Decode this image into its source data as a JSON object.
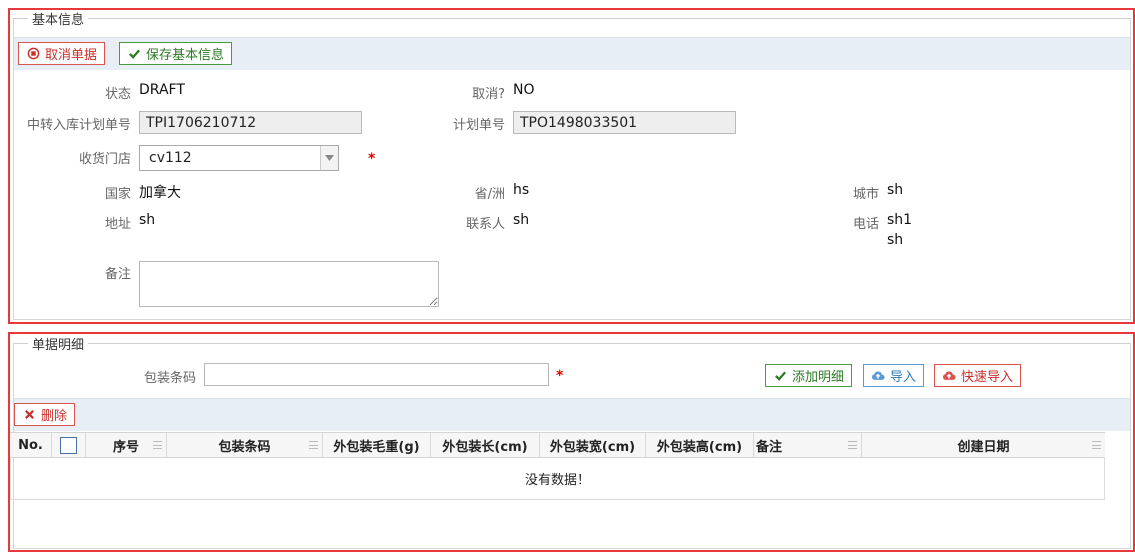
{
  "basic_info": {
    "legend": "基本信息",
    "cancel_button": "取消单据",
    "save_button": "保存基本信息",
    "status_label": "状态",
    "status_value": "DRAFT",
    "canceled_label": "取消?",
    "canceled_value": "NO",
    "transfer_plan_label": "中转入库计划单号",
    "transfer_plan_value": "TPI1706210712",
    "plan_no_label": "计划单号",
    "plan_no_value": "TPO1498033501",
    "store_label": "收货门店",
    "store_value": "cv112",
    "country_label": "国家",
    "country_value": "加拿大",
    "province_label": "省/洲",
    "province_value": "hs",
    "city_label": "城市",
    "city_value": "sh",
    "address_label": "地址",
    "address_value": "sh",
    "contact_label": "联系人",
    "contact_value": "sh",
    "phone_label": "电话",
    "phone_value_1": "sh1",
    "phone_value_2": "sh",
    "remark_label": "备注",
    "remark_value": "",
    "required_mark": "*"
  },
  "detail": {
    "legend": "单据明细",
    "barcode_label": "包装条码",
    "barcode_value": "",
    "add_button": "添加明细",
    "import_button": "导入",
    "quick_import_button": "快速导入",
    "delete_button": "删除",
    "columns": {
      "no": "No.",
      "seq": "序号",
      "barcode": "包装条码",
      "weight": "外包装毛重(g)",
      "length": "外包装长(cm)",
      "width": "外包装宽(cm)",
      "height": "外包装高(cm)",
      "remark": "备注",
      "created": "创建日期"
    },
    "empty_text": "没有数据！"
  },
  "colors": {
    "highlight_border": "#e8393a",
    "danger": "#c9302c",
    "success": "#2d7a25",
    "info": "#337ab7"
  },
  "icons": [
    "stop-circle-icon",
    "check-icon",
    "cloud-upload-icon",
    "times-icon",
    "chevron-down-icon"
  ]
}
